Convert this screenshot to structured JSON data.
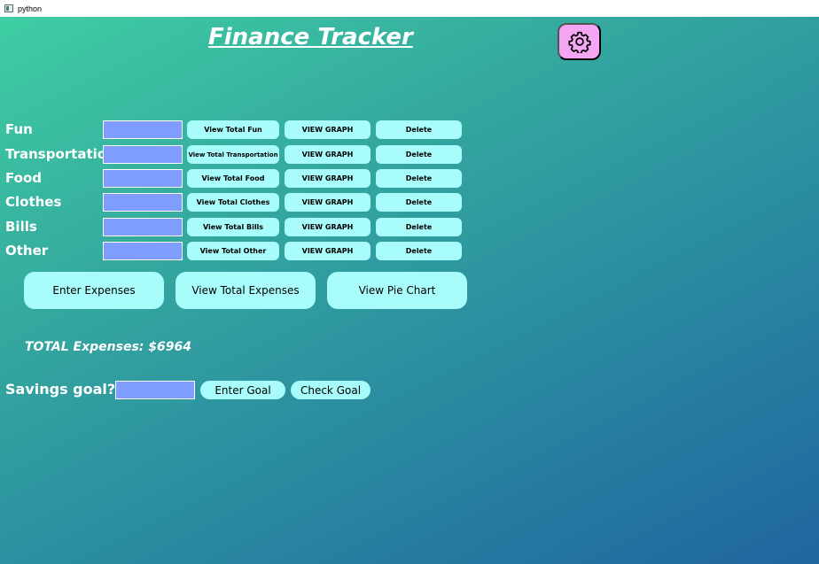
{
  "window": {
    "title": "python"
  },
  "app": {
    "title": "Finance Tracker",
    "settings_icon": "gear-icon"
  },
  "categories": [
    {
      "label": "Fun",
      "total_label": "View Total  Fun",
      "graph_label": "VIEW GRAPH",
      "delete_label": "Delete",
      "value": ""
    },
    {
      "label": "Transportation",
      "total_label": "View Total Transportation",
      "graph_label": "VIEW GRAPH",
      "delete_label": "Delete",
      "value": ""
    },
    {
      "label": "Food",
      "total_label": "View Total Food",
      "graph_label": "VIEW GRAPH",
      "delete_label": "Delete",
      "value": ""
    },
    {
      "label": "Clothes",
      "total_label": "View Total Clothes",
      "graph_label": "VIEW GRAPH",
      "delete_label": "Delete",
      "value": ""
    },
    {
      "label": "Bills",
      "total_label": "View Total Bills",
      "graph_label": "VIEW GRAPH",
      "delete_label": "Delete",
      "value": ""
    },
    {
      "label": "Other",
      "total_label": "View Total Other",
      "graph_label": "VIEW GRAPH",
      "delete_label": "Delete",
      "value": ""
    }
  ],
  "actions": {
    "enter_expenses": "Enter Expenses",
    "view_total_expenses": "View Total Expenses",
    "view_pie_chart": "View Pie Chart"
  },
  "total": {
    "text": "TOTAL Expenses: $6964"
  },
  "savings": {
    "label": "Savings goal?",
    "value": "",
    "enter_goal": "Enter Goal",
    "check_goal": "Check Goal"
  },
  "colors": {
    "accent_button": "#a8fdfc",
    "input_fill": "#7f9cff",
    "settings_button": "#f4a6f2",
    "gradient_start": "#3fcea3",
    "gradient_end": "#1f65a0"
  }
}
